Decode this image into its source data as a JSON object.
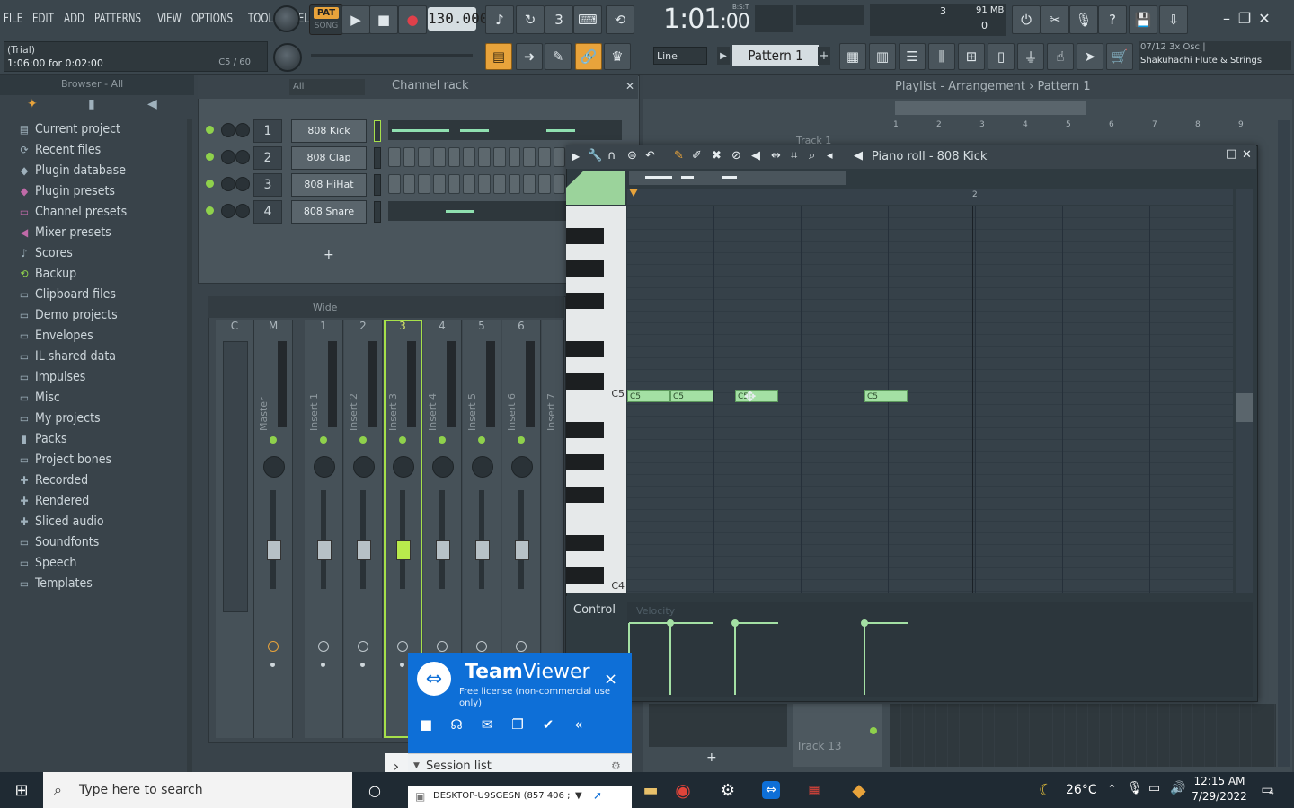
{
  "menu": [
    "FILE",
    "EDIT",
    "ADD",
    "PATTERNS",
    "VIEW",
    "OPTIONS",
    "TOOLS",
    "HELP"
  ],
  "transport": {
    "pat_label": "PAT",
    "song_label": "SONG",
    "tempo": "130.000",
    "time_main": "1:01",
    "time_sub": ":00",
    "time_tag": "B:S:T"
  },
  "cpu": {
    "value": "3",
    "mem": "91 MB",
    "poly": "0"
  },
  "hint": {
    "line1": "(Trial)",
    "line2": "1:06:00 for 0:02:00",
    "right": "C5 / 60"
  },
  "toolbar2": {
    "snap": "Line",
    "pattern": "Pattern 1",
    "plus": "+"
  },
  "song_info": {
    "line1": "07/12  3x Osc |",
    "line2": "Shakuhachi Flute & Strings"
  },
  "browser": {
    "title": "Browser - All",
    "items": [
      {
        "label": "Current project",
        "icon": "project-icon"
      },
      {
        "label": "Recent files",
        "icon": "recent-icon"
      },
      {
        "label": "Plugin database",
        "icon": "plugin-icon"
      },
      {
        "label": "Plugin presets",
        "icon": "plugin-icon"
      },
      {
        "label": "Channel presets",
        "icon": "channel-icon"
      },
      {
        "label": "Mixer presets",
        "icon": "mixer-icon"
      },
      {
        "label": "Scores",
        "icon": "note-icon"
      },
      {
        "label": "Backup",
        "icon": "backup-icon"
      },
      {
        "label": "Clipboard files",
        "icon": "folder-icon"
      },
      {
        "label": "Demo projects",
        "icon": "folder-icon"
      },
      {
        "label": "Envelopes",
        "icon": "folder-icon"
      },
      {
        "label": "IL shared data",
        "icon": "folder-icon"
      },
      {
        "label": "Impulses",
        "icon": "folder-icon"
      },
      {
        "label": "Misc",
        "icon": "folder-icon"
      },
      {
        "label": "My projects",
        "icon": "folder-icon"
      },
      {
        "label": "Packs",
        "icon": "packs-icon"
      },
      {
        "label": "Project bones",
        "icon": "folder-icon"
      },
      {
        "label": "Recorded",
        "icon": "record-icon"
      },
      {
        "label": "Rendered",
        "icon": "record-icon"
      },
      {
        "label": "Sliced audio",
        "icon": "record-icon"
      },
      {
        "label": "Soundfonts",
        "icon": "folder-icon"
      },
      {
        "label": "Speech",
        "icon": "folder-icon"
      },
      {
        "label": "Templates",
        "icon": "folder-icon"
      }
    ]
  },
  "channel_rack": {
    "title": "Channel rack",
    "filter": "All",
    "channels": [
      {
        "num": "1",
        "name": "808 Kick"
      },
      {
        "num": "2",
        "name": "808 Clap"
      },
      {
        "num": "3",
        "name": "808 HiHat"
      },
      {
        "num": "4",
        "name": "808 Snare"
      }
    ],
    "add": "+"
  },
  "mixer": {
    "preset": "Wide",
    "tracks": [
      {
        "head": "C",
        "label": ""
      },
      {
        "head": "M",
        "label": "Master"
      },
      {
        "head": "1",
        "label": "Insert 1"
      },
      {
        "head": "2",
        "label": "Insert 2"
      },
      {
        "head": "3",
        "label": "Insert 3"
      },
      {
        "head": "4",
        "label": "Insert 4"
      },
      {
        "head": "5",
        "label": "Insert 5"
      },
      {
        "head": "6",
        "label": "Insert 6"
      },
      {
        "head": "",
        "label": "Insert 7"
      }
    ]
  },
  "playlist": {
    "title": "Playlist - Arrangement",
    "pattern": "Pattern 1",
    "ruler": [
      "1",
      "2",
      "3",
      "4",
      "5",
      "6",
      "7",
      "8",
      "9"
    ],
    "track_first": "Track 1",
    "track_last": "Track 13",
    "add": "+"
  },
  "piano_roll": {
    "title": "Piano roll - 808 Kick",
    "bar2": "2",
    "key_c5": "C5",
    "key_c4": "C4",
    "control": "Control",
    "velocity": "Velocity",
    "notes": [
      "C5",
      "C5",
      "C5",
      "C5"
    ]
  },
  "teamviewer": {
    "brand_a": "Team",
    "brand_b": "Viewer",
    "license": "Free license (non-commercial use only)",
    "session": "Session list",
    "device": "DESKTOP-U9SGESN (857 406 ;",
    "close": "×"
  },
  "taskbar": {
    "search": "Type here to search",
    "temp": "26°C",
    "time": "12:15 AM",
    "date": "7/29/2022",
    "notif": "4"
  }
}
